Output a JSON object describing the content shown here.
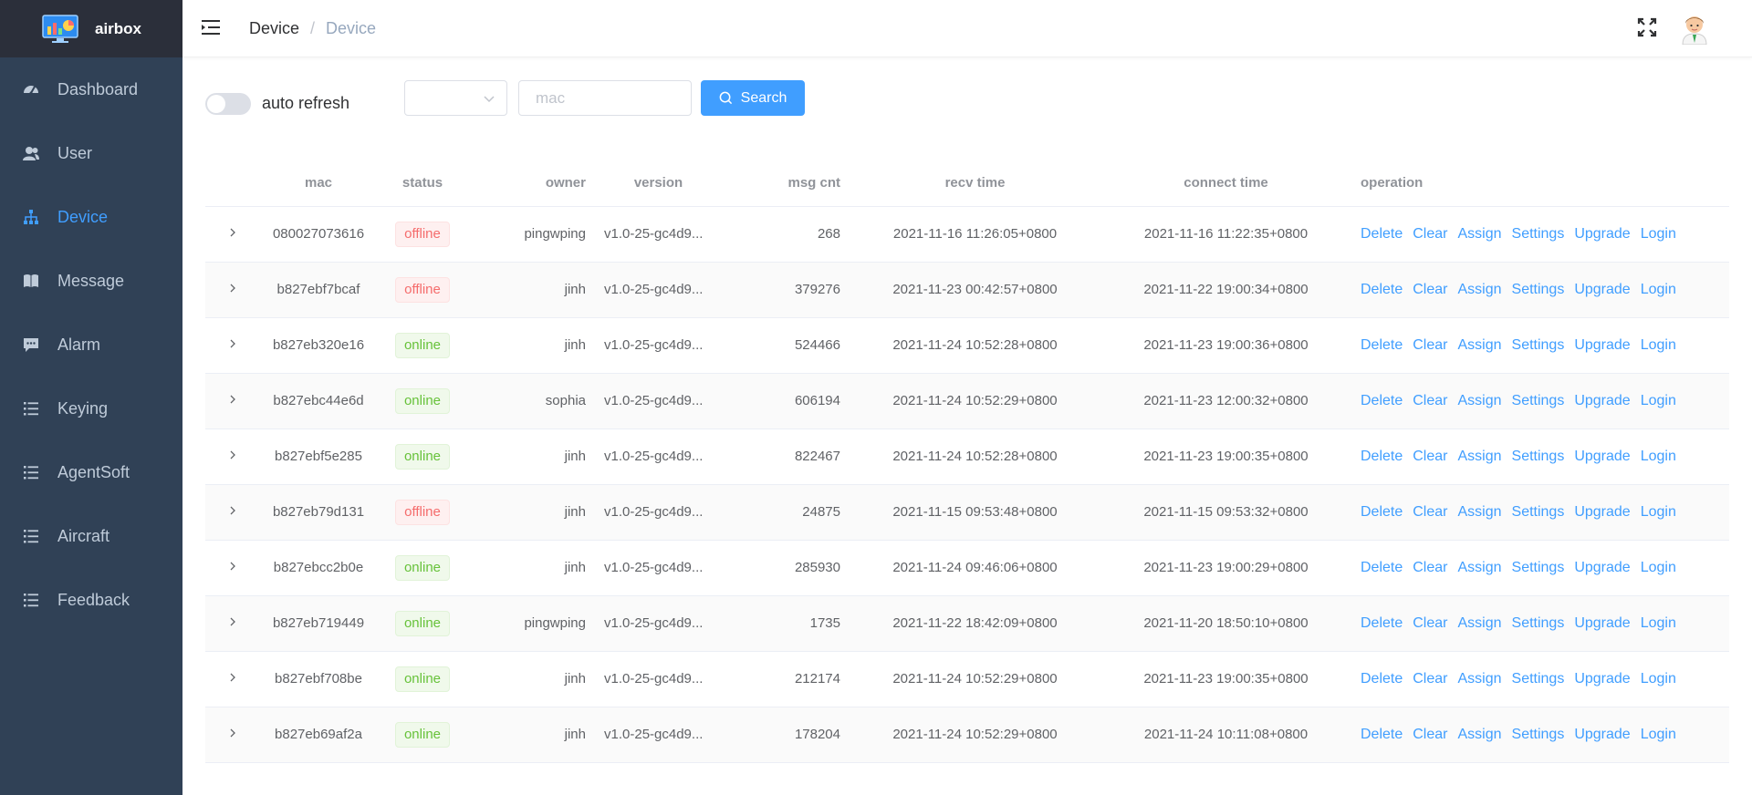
{
  "brand": {
    "name": "airbox"
  },
  "sidebar": {
    "items": [
      {
        "label": "Dashboard",
        "icon": "dashboard-icon",
        "active": false
      },
      {
        "label": "User",
        "icon": "user-icon",
        "active": false
      },
      {
        "label": "Device",
        "icon": "tree-icon",
        "active": true
      },
      {
        "label": "Message",
        "icon": "book-icon",
        "active": false
      },
      {
        "label": "Alarm",
        "icon": "chat-icon",
        "active": false
      },
      {
        "label": "Keying",
        "icon": "list-icon",
        "active": false
      },
      {
        "label": "AgentSoft",
        "icon": "list-icon",
        "active": false
      },
      {
        "label": "Aircraft",
        "icon": "list-icon",
        "active": false
      },
      {
        "label": "Feedback",
        "icon": "list-icon",
        "active": false
      }
    ]
  },
  "breadcrumb": {
    "parent": "Device",
    "separator": "/",
    "current": "Device"
  },
  "toolbar": {
    "auto_refresh_label": "auto refresh",
    "select_value": "",
    "mac_placeholder": "mac",
    "mac_value": "",
    "search_label": "Search"
  },
  "table": {
    "columns": [
      "mac",
      "status",
      "owner",
      "version",
      "msg cnt",
      "recv time",
      "connect time",
      "operation"
    ],
    "operations": [
      "Delete",
      "Clear",
      "Assign",
      "Settings",
      "Upgrade",
      "Login"
    ],
    "rows": [
      {
        "mac": "080027073616",
        "status": "offline",
        "owner": "pingwping",
        "version": "v1.0-25-gc4d9...",
        "msg_cnt": "268",
        "recv_time": "2021-11-16 11:26:05+0800",
        "connect_time": "2021-11-16 11:22:35+0800"
      },
      {
        "mac": "b827ebf7bcaf",
        "status": "offline",
        "owner": "jinh",
        "version": "v1.0-25-gc4d9...",
        "msg_cnt": "379276",
        "recv_time": "2021-11-23 00:42:57+0800",
        "connect_time": "2021-11-22 19:00:34+0800"
      },
      {
        "mac": "b827eb320e16",
        "status": "online",
        "owner": "jinh",
        "version": "v1.0-25-gc4d9...",
        "msg_cnt": "524466",
        "recv_time": "2021-11-24 10:52:28+0800",
        "connect_time": "2021-11-23 19:00:36+0800"
      },
      {
        "mac": "b827ebc44e6d",
        "status": "online",
        "owner": "sophia",
        "version": "v1.0-25-gc4d9...",
        "msg_cnt": "606194",
        "recv_time": "2021-11-24 10:52:29+0800",
        "connect_time": "2021-11-23 12:00:32+0800"
      },
      {
        "mac": "b827ebf5e285",
        "status": "online",
        "owner": "jinh",
        "version": "v1.0-25-gc4d9...",
        "msg_cnt": "822467",
        "recv_time": "2021-11-24 10:52:28+0800",
        "connect_time": "2021-11-23 19:00:35+0800"
      },
      {
        "mac": "b827eb79d131",
        "status": "offline",
        "owner": "jinh",
        "version": "v1.0-25-gc4d9...",
        "msg_cnt": "24875",
        "recv_time": "2021-11-15 09:53:48+0800",
        "connect_time": "2021-11-15 09:53:32+0800"
      },
      {
        "mac": "b827ebcc2b0e",
        "status": "online",
        "owner": "jinh",
        "version": "v1.0-25-gc4d9...",
        "msg_cnt": "285930",
        "recv_time": "2021-11-24 09:46:06+0800",
        "connect_time": "2021-11-23 19:00:29+0800"
      },
      {
        "mac": "b827eb719449",
        "status": "online",
        "owner": "pingwping",
        "version": "v1.0-25-gc4d9...",
        "msg_cnt": "1735",
        "recv_time": "2021-11-22 18:42:09+0800",
        "connect_time": "2021-11-20 18:50:10+0800"
      },
      {
        "mac": "b827ebf708be",
        "status": "online",
        "owner": "jinh",
        "version": "v1.0-25-gc4d9...",
        "msg_cnt": "212174",
        "recv_time": "2021-11-24 10:52:29+0800",
        "connect_time": "2021-11-23 19:00:35+0800"
      },
      {
        "mac": "b827eb69af2a",
        "status": "online",
        "owner": "jinh",
        "version": "v1.0-25-gc4d9...",
        "msg_cnt": "178204",
        "recv_time": "2021-11-24 10:52:29+0800",
        "connect_time": "2021-11-24 10:11:08+0800"
      }
    ]
  },
  "colors": {
    "sidebar_bg": "#304156",
    "brand_bg": "#2b2f3a",
    "accent": "#409eff",
    "online": "#67c23a",
    "offline": "#f56c6c"
  }
}
